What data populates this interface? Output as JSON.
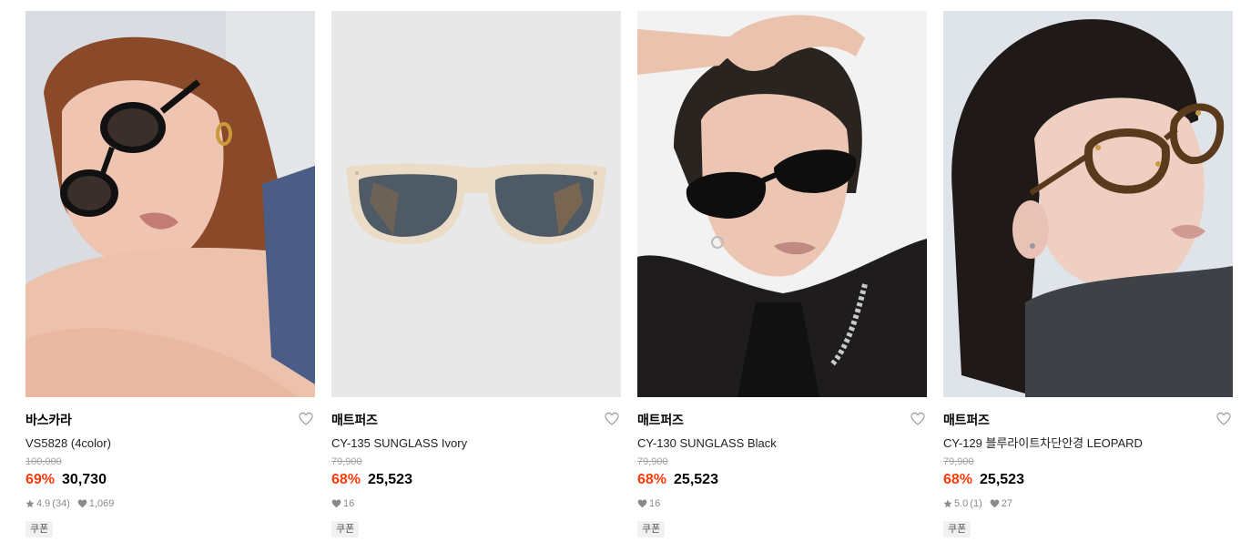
{
  "products": [
    {
      "brand": "바스카라",
      "name": "VS5828 (4color)",
      "original_price": "100,000",
      "discount": "69%",
      "price": "30,730",
      "rating": "4.9",
      "review_count": "(34)",
      "likes": "1,069",
      "badge": "쿠폰",
      "image_icon": "model-wearing-black-oval-sunglasses"
    },
    {
      "brand": "매트퍼즈",
      "name": "CY-135 SUNGLASS Ivory",
      "original_price": "79,900",
      "discount": "68%",
      "price": "25,523",
      "likes": "16",
      "badge": "쿠폰",
      "image_icon": "ivory-frame-sunglasses-product"
    },
    {
      "brand": "매트퍼즈",
      "name": "CY-130 SUNGLASS Black",
      "original_price": "79,900",
      "discount": "68%",
      "price": "25,523",
      "likes": "16",
      "badge": "쿠폰",
      "image_icon": "model-wearing-black-sunglasses"
    },
    {
      "brand": "매트퍼즈",
      "name": "CY-129 블루라이트차단안경 LEOPARD",
      "original_price": "79,900",
      "discount": "68%",
      "price": "25,523",
      "rating": "5.0",
      "review_count": "(1)",
      "likes": "27",
      "badge": "쿠폰",
      "image_icon": "model-wearing-leopard-glasses"
    }
  ],
  "colors": {
    "discount": "#ff3b0a",
    "original_price": "#a0a0a0",
    "stats": "#8a8a8a",
    "badge_bg": "#f1f1f1"
  }
}
